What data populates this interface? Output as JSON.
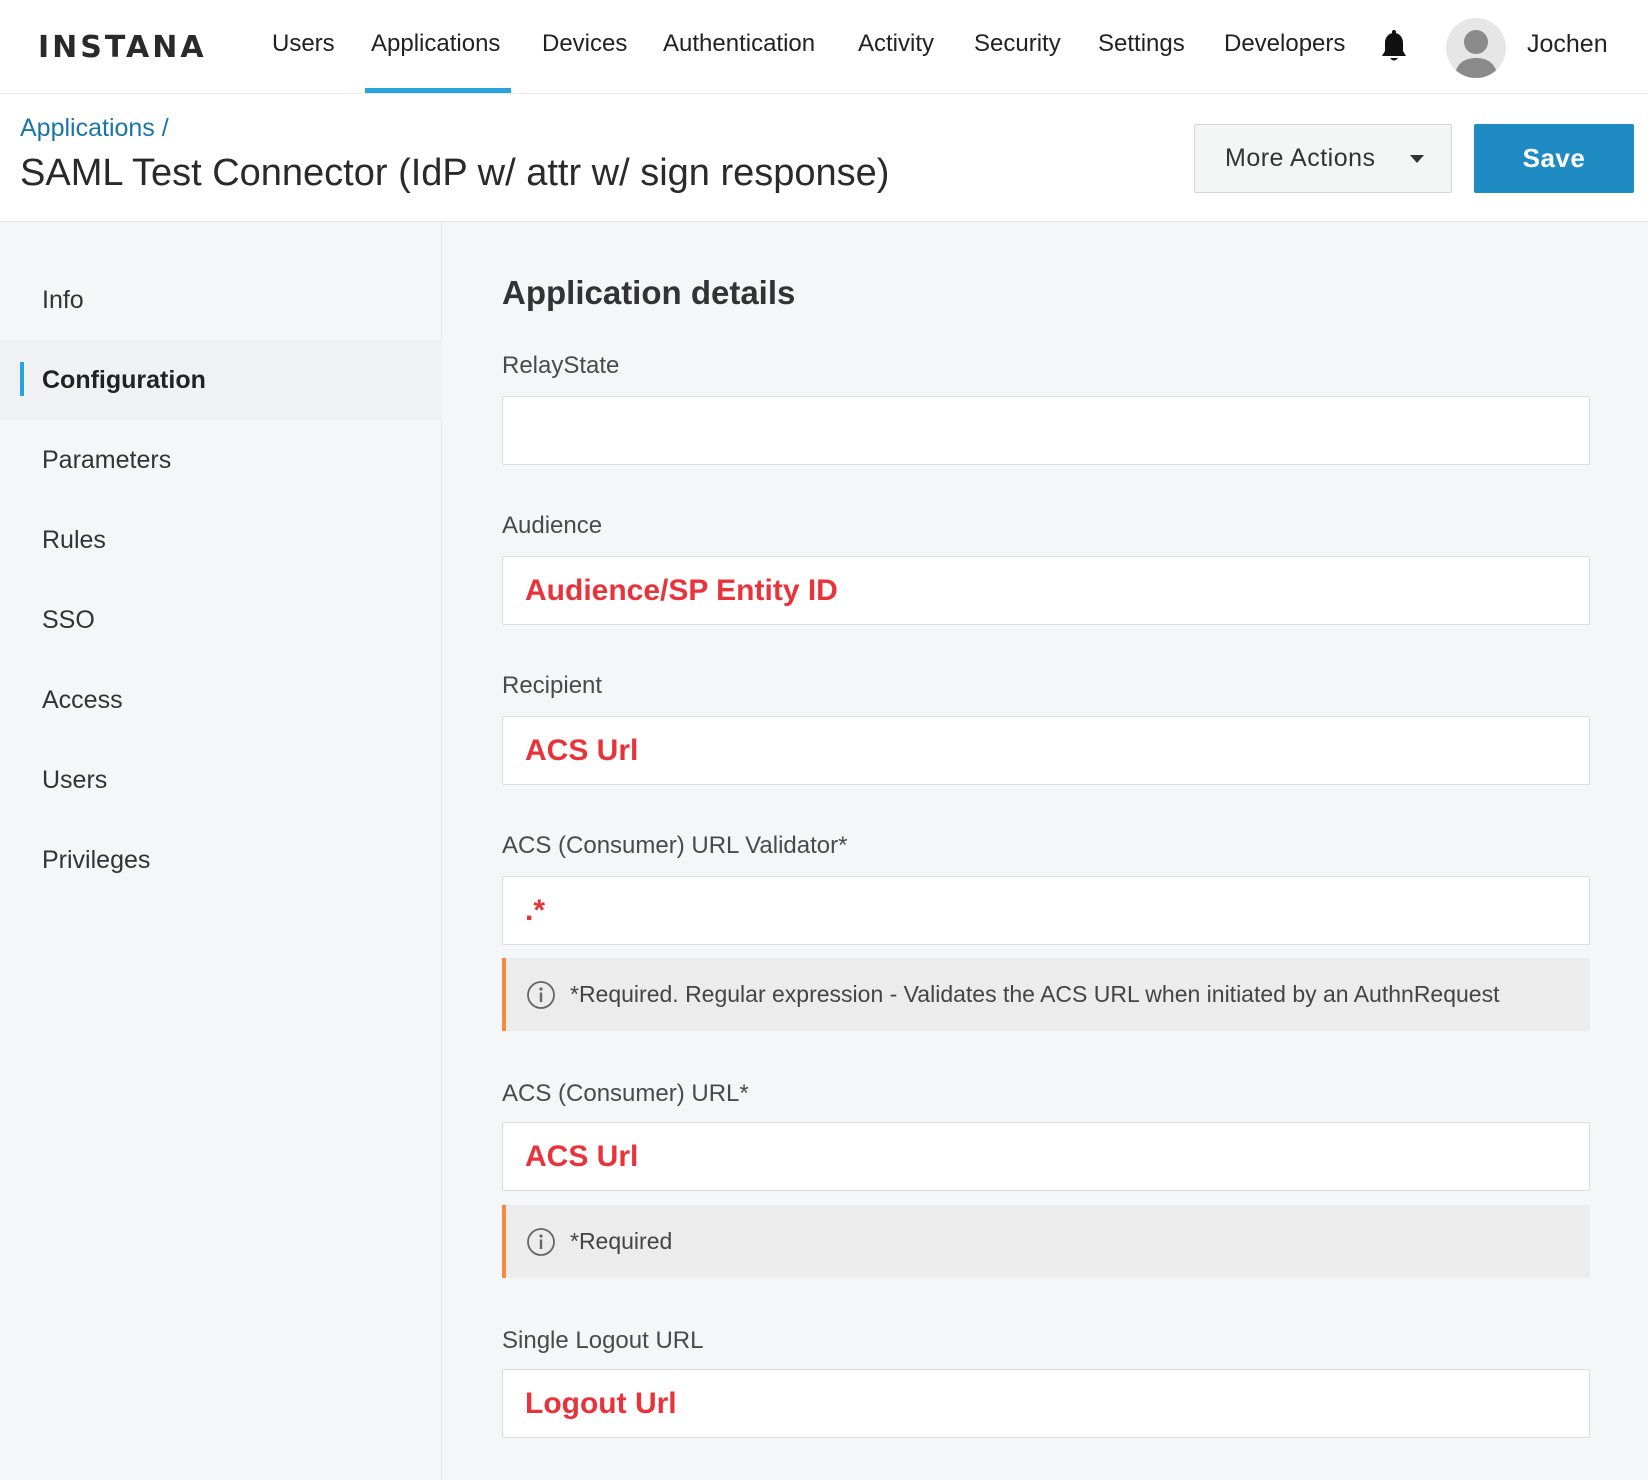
{
  "brand": {
    "logo_text": "INSTANA"
  },
  "nav": {
    "items": [
      {
        "label": "Users"
      },
      {
        "label": "Applications",
        "active": true
      },
      {
        "label": "Devices"
      },
      {
        "label": "Authentication"
      },
      {
        "label": "Activity"
      },
      {
        "label": "Security"
      },
      {
        "label": "Settings"
      },
      {
        "label": "Developers"
      }
    ],
    "bell_icon": "bell-icon",
    "avatar_icon": "user-avatar-icon",
    "user_name": "Jochen",
    "accent_color": "#29a3dc"
  },
  "header": {
    "breadcrumb": "Applications /",
    "title": "SAML Test Connector (IdP w/ attr w/ sign response)",
    "more_actions_label": "More Actions",
    "save_label": "Save",
    "save_color": "#1e8bc3"
  },
  "sidebar": {
    "items": [
      {
        "label": "Info"
      },
      {
        "label": "Configuration",
        "active": true
      },
      {
        "label": "Parameters"
      },
      {
        "label": "Rules"
      },
      {
        "label": "SSO"
      },
      {
        "label": "Access"
      },
      {
        "label": "Users"
      },
      {
        "label": "Privileges"
      }
    ]
  },
  "main": {
    "section_title": "Application details",
    "fields": {
      "relay_state": {
        "label": "RelayState",
        "value": ""
      },
      "audience": {
        "label": "Audience",
        "value": "Audience/SP Entity ID"
      },
      "recipient": {
        "label": "Recipient",
        "value": "ACS Url"
      },
      "acs_validator": {
        "label": "ACS (Consumer) URL Validator*",
        "value": ".*",
        "hint": "*Required. Regular expression - Validates the ACS URL when initiated by an AuthnRequest"
      },
      "acs_url": {
        "label": "ACS (Consumer) URL*",
        "value": "ACS Url",
        "hint": "*Required"
      },
      "single_logout": {
        "label": "Single Logout URL",
        "value": "Logout Url"
      }
    },
    "value_color": "#e8333a",
    "hint_accent_color": "#f58a3c"
  }
}
